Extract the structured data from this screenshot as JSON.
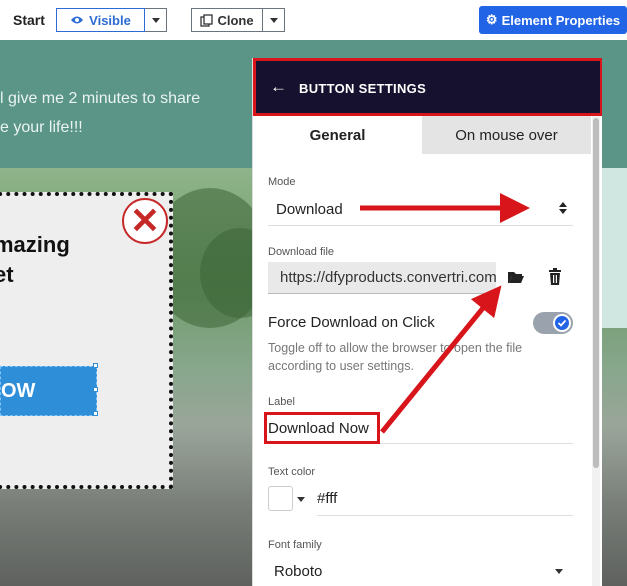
{
  "toolbar": {
    "start_label": "Start",
    "visible_label": "Visible",
    "clone_label": "Clone",
    "element_properties_label": "Element Properties"
  },
  "canvas": {
    "hero_line_1": "l give me 2 minutes to share",
    "hero_line_2": "e your life!!!",
    "popup_heading_1": "mazing",
    "popup_heading_2": "et",
    "popup_button_label": "OW"
  },
  "panel": {
    "title": "BUTTON SETTINGS",
    "tabs": [
      {
        "label": "General",
        "active": true
      },
      {
        "label": "On mouse over",
        "active": false
      }
    ],
    "mode": {
      "label": "Mode",
      "value": "Download"
    },
    "download_file": {
      "label": "Download file",
      "value": "https://dfyproducts.convertri.com"
    },
    "force_download": {
      "label": "Force Download on Click",
      "enabled": true,
      "help": "Toggle off to allow the browser to open the file according to user settings."
    },
    "label_field": {
      "label": "Label",
      "value": "Download Now"
    },
    "text_color": {
      "label": "Text color",
      "value": "#fff"
    },
    "font_family": {
      "label": "Font family",
      "value": "Roboto"
    }
  },
  "colors": {
    "accent": "#2264e6",
    "header_bg": "#16112e",
    "annotation_red": "#d7151b",
    "hero_teal": "#5b9587"
  }
}
